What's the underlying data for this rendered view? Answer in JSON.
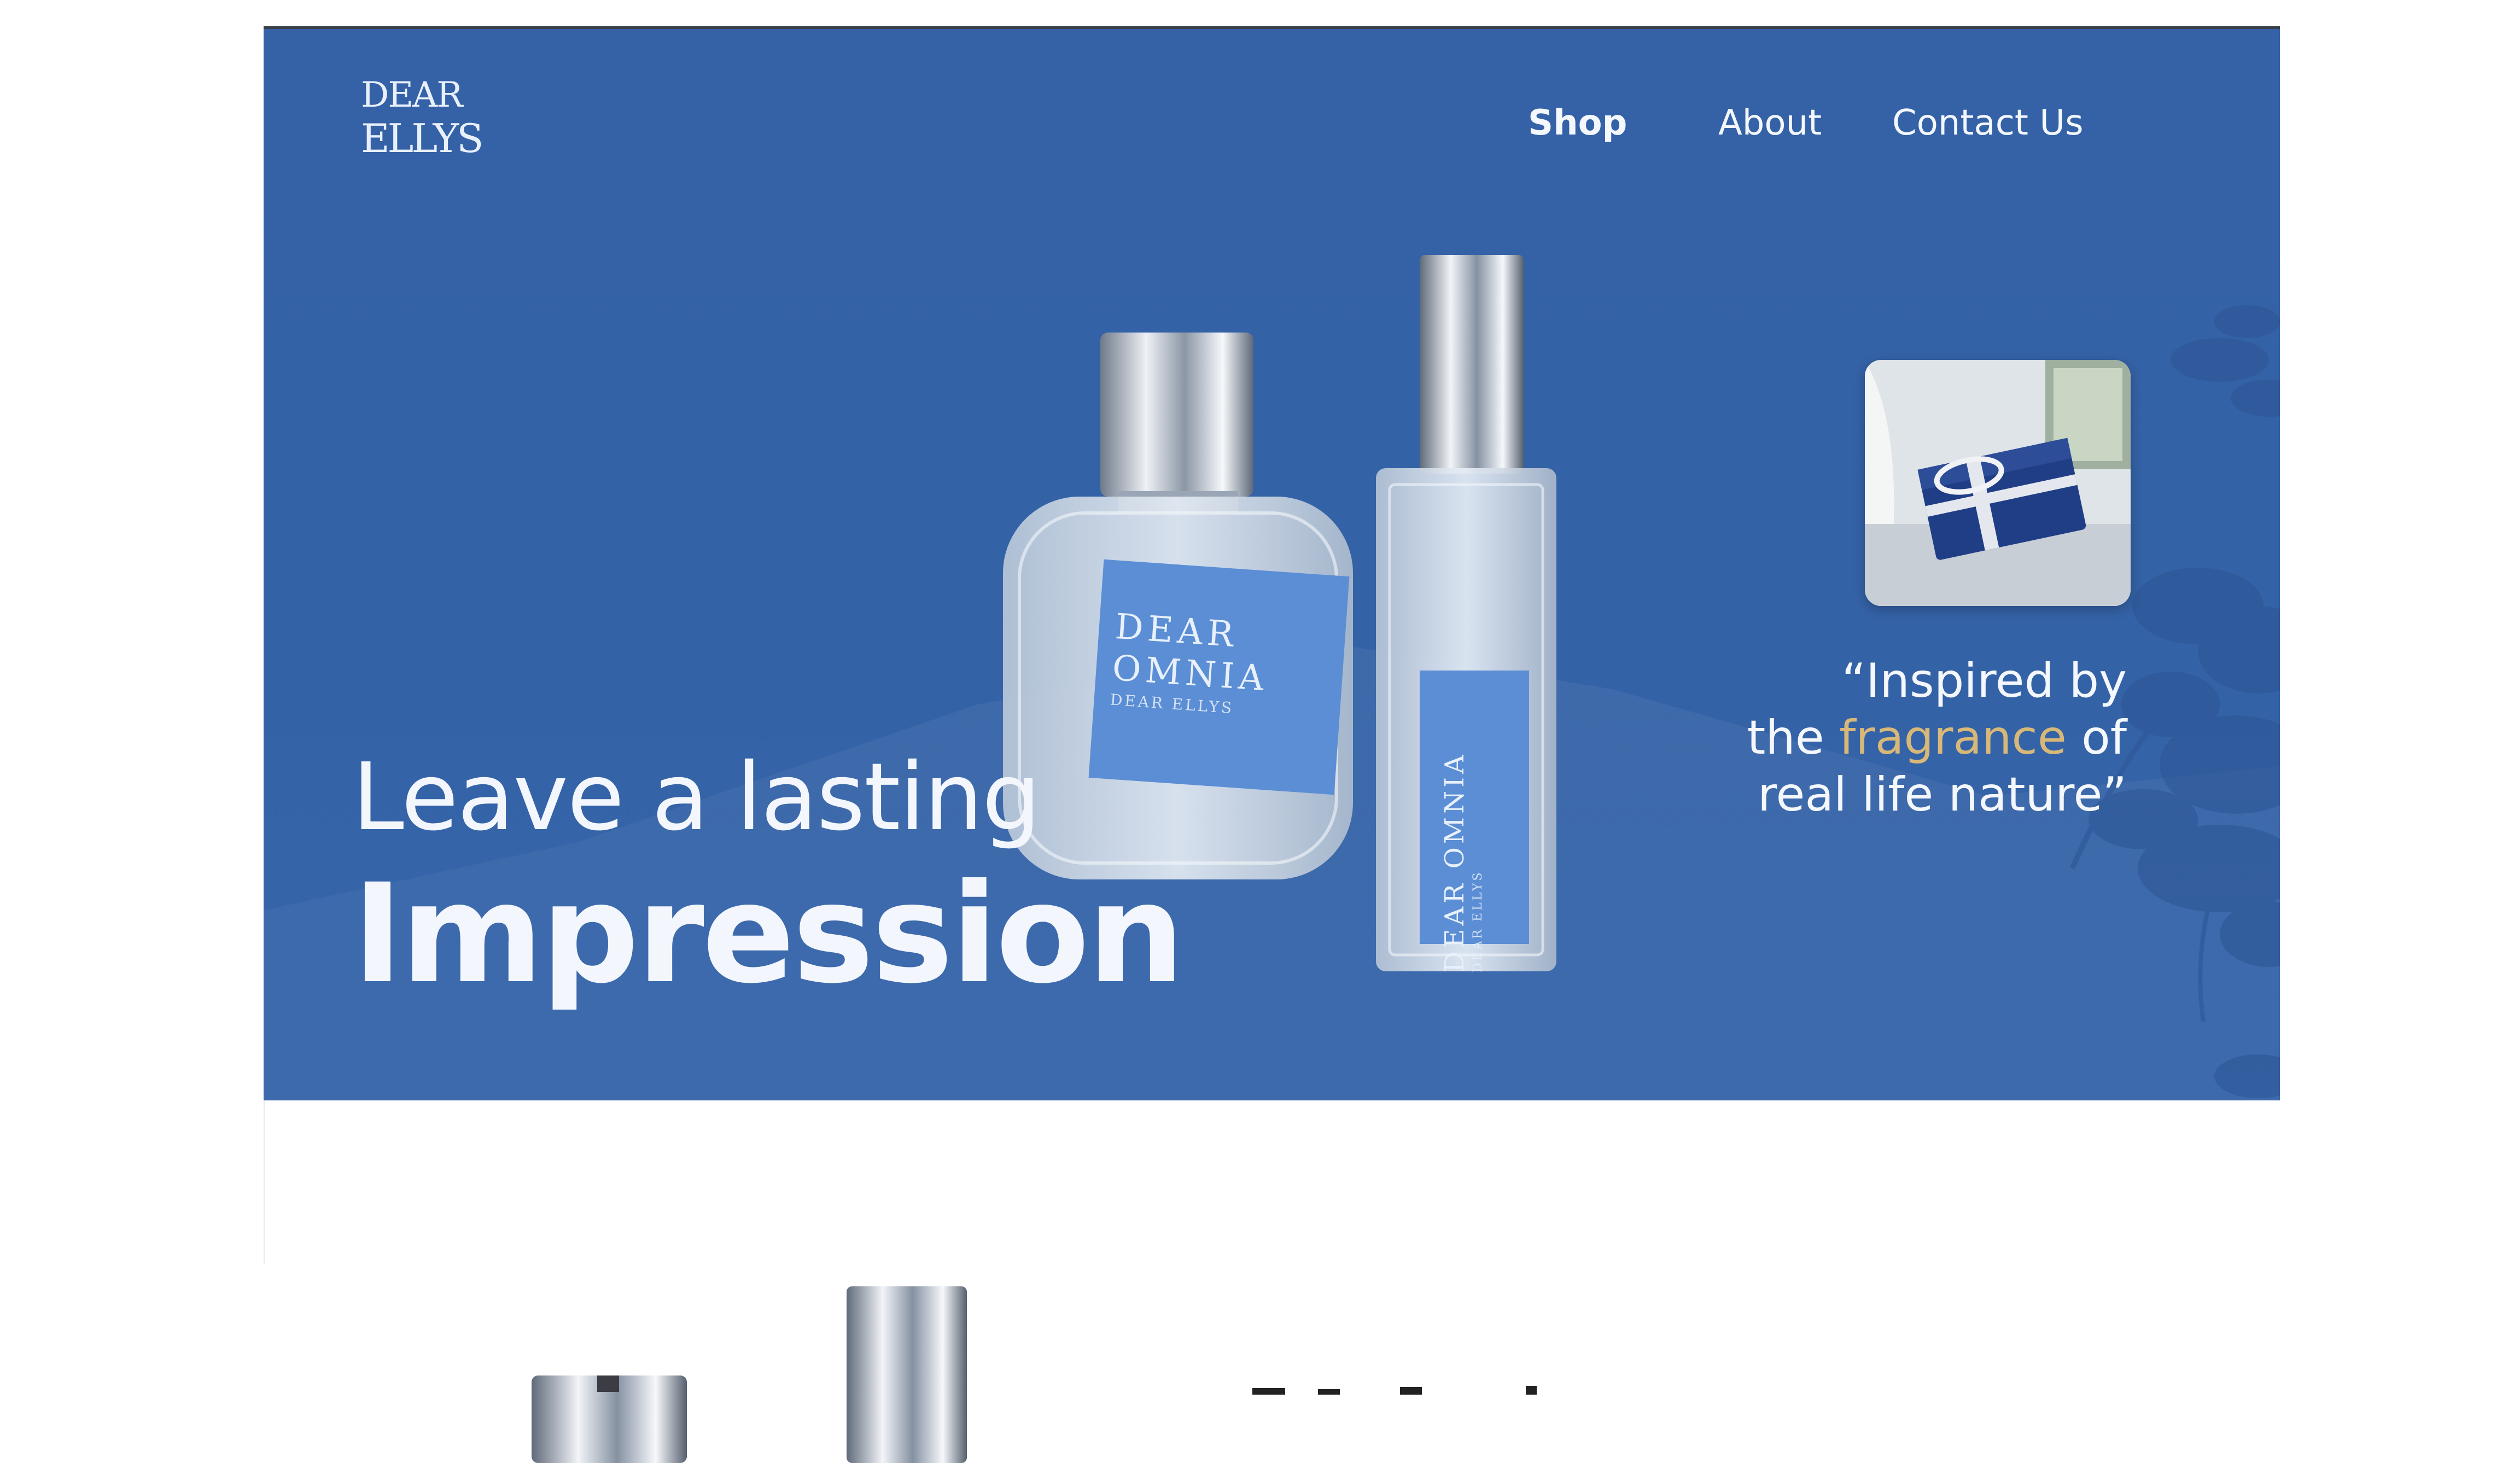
{
  "brand": {
    "line1": "DEAR",
    "line2": "ELLYS"
  },
  "nav": {
    "shop": "Shop",
    "about": "About",
    "contact": "Contact Us"
  },
  "hero": {
    "headline_line1": "Leave a lasting",
    "headline_line2": "Impression",
    "quote_line1": "“Inspired by",
    "quote_line2_pre": "the",
    "quote_line2_accent": "fragrance",
    "quote_line2_post": "of",
    "quote_line3": "real life nature”"
  },
  "product": {
    "label_line1": "DEAR",
    "label_line2": "OMNIA",
    "label_line3": "DEAR ELLYS",
    "tall_label": "DEAR OMNIA",
    "tall_sub": "DEAR ELLYS"
  },
  "colors": {
    "hero_bg": "#3462a6",
    "accent": "#d8b878",
    "label_blue": "#5b8ed4",
    "text": "#f4f7fc"
  },
  "icons": {
    "gift_image": "gift-box-photo",
    "foliage": "leaf-silhouette"
  }
}
